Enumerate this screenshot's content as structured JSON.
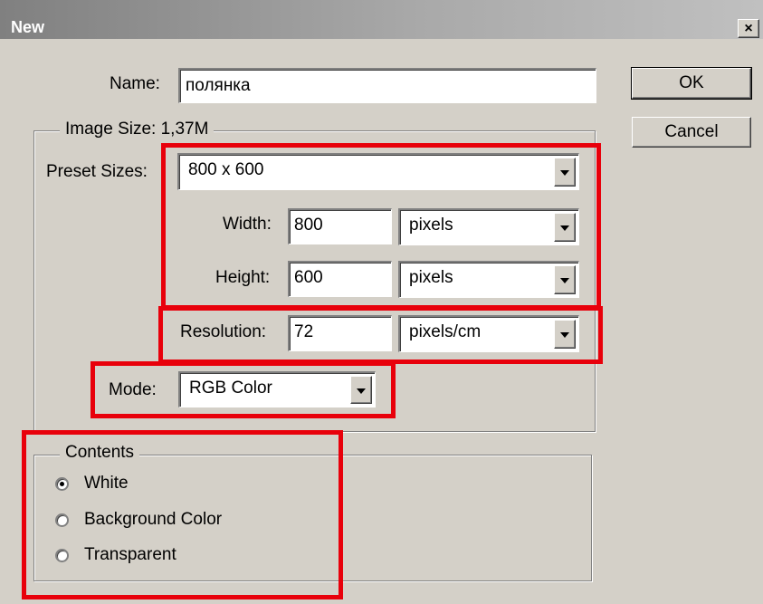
{
  "window": {
    "title": "New",
    "close_label": "×"
  },
  "name": {
    "label": "Name:",
    "value": "полянка"
  },
  "buttons": {
    "ok": "OK",
    "cancel": "Cancel"
  },
  "image_size": {
    "title": "Image Size: 1,37M",
    "preset": {
      "label": "Preset Sizes:",
      "value": "800 x 600"
    },
    "width": {
      "label": "Width:",
      "value": "800",
      "unit": "pixels"
    },
    "height": {
      "label": "Height:",
      "value": "600",
      "unit": "pixels"
    },
    "resolution": {
      "label": "Resolution:",
      "value": "72",
      "unit": "pixels/cm"
    },
    "mode": {
      "label": "Mode:",
      "value": "RGB Color"
    }
  },
  "contents": {
    "title": "Contents",
    "options": [
      {
        "label": "White",
        "checked": true
      },
      {
        "label": "Background Color",
        "checked": false
      },
      {
        "label": "Transparent",
        "checked": false
      }
    ]
  },
  "colors": {
    "dialog_bg": "#d4d0c8",
    "highlight": "#e8000b"
  }
}
